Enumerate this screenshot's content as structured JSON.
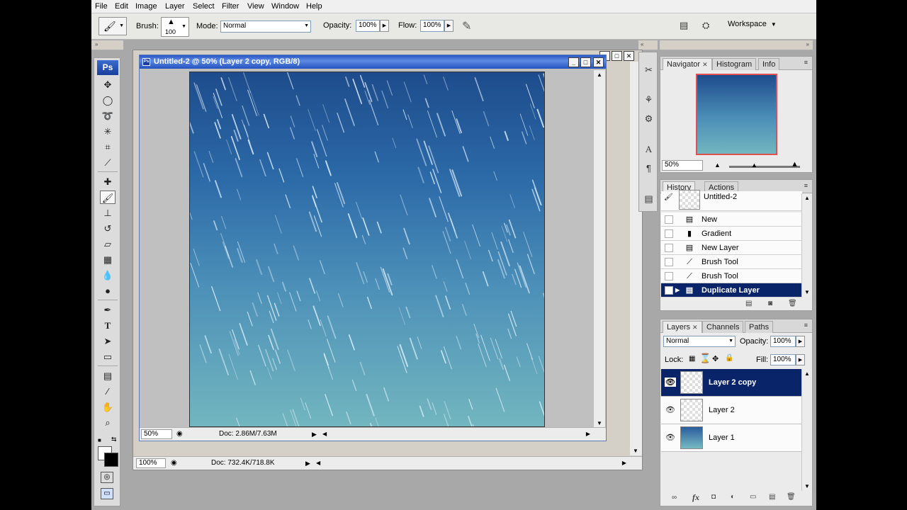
{
  "menu": [
    "File",
    "Edit",
    "Image",
    "Layer",
    "Select",
    "Filter",
    "View",
    "Window",
    "Help"
  ],
  "options": {
    "brush_label": "Brush:",
    "brush_size": "100",
    "mode_label": "Mode:",
    "mode_value": "Normal",
    "opacity_label": "Opacity:",
    "opacity_value": "100%",
    "flow_label": "Flow:",
    "flow_value": "100%",
    "workspace_label": "Workspace"
  },
  "toolbox": {
    "logo": "Ps"
  },
  "document": {
    "title": "Untitled-2 @ 50% (Layer 2 copy, RGB/8)",
    "zoom": "50%",
    "doc_size": "Doc: 2.86M/7.63M"
  },
  "outer_document": {
    "zoom": "100%",
    "doc_size": "Doc: 732.4K/718.8K"
  },
  "navigator": {
    "tabs": [
      "Navigator",
      "Histogram",
      "Info"
    ],
    "zoom": "50%"
  },
  "history": {
    "tabs": [
      "History",
      "Actions"
    ],
    "snapshot": "Untitled-2",
    "items": [
      {
        "label": "New",
        "icon": "document-icon"
      },
      {
        "label": "Gradient",
        "icon": "gradient-icon"
      },
      {
        "label": "New Layer",
        "icon": "document-icon"
      },
      {
        "label": "Brush Tool",
        "icon": "brush-icon"
      },
      {
        "label": "Brush Tool",
        "icon": "brush-icon"
      },
      {
        "label": "Duplicate Layer",
        "icon": "document-icon"
      }
    ]
  },
  "layers": {
    "tabs": [
      "Layers",
      "Channels",
      "Paths"
    ],
    "blend_mode": "Normal",
    "opacity_label": "Opacity:",
    "opacity_value": "100%",
    "lock_label": "Lock:",
    "fill_label": "Fill:",
    "fill_value": "100%",
    "items": [
      {
        "name": "Layer 2 copy",
        "thumb": "transparent"
      },
      {
        "name": "Layer 2",
        "thumb": "transparent"
      },
      {
        "name": "Layer 1",
        "thumb": "gradient"
      }
    ]
  },
  "colors": {
    "selection": "#0a246a",
    "title_bar": "#2b57c9",
    "canvas_top": "#1e4c8c",
    "canvas_bottom": "#72b6bf"
  }
}
